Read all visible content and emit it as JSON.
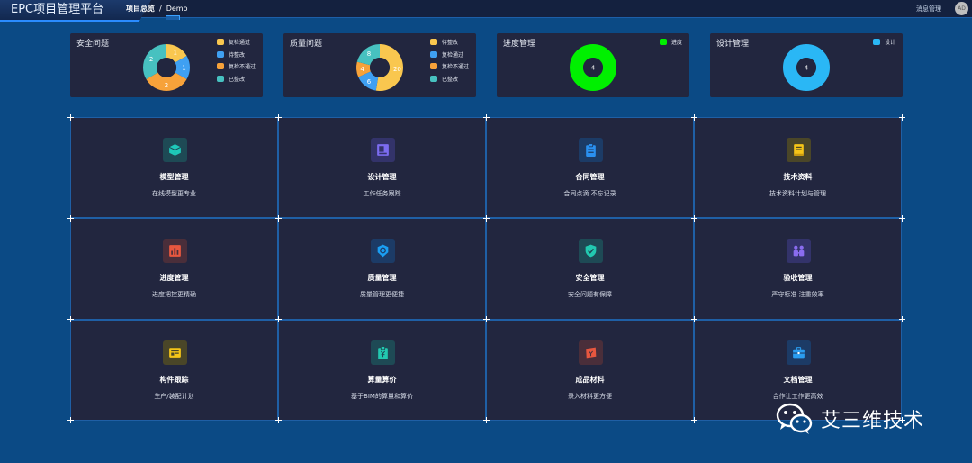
{
  "header": {
    "title": "EPC项目管理平台",
    "breadcrumb": [
      "项目总览",
      "Demo"
    ],
    "breadcrumb_sep": "/",
    "messages": "消息管理",
    "avatar": "AD"
  },
  "stats": [
    {
      "title": "安全问题",
      "legend": [
        {
          "label": "复检通过",
          "color": "#f9c74f"
        },
        {
          "label": "待整改",
          "color": "#3fa0f2"
        },
        {
          "label": "复检不通过",
          "color": "#f7a23a"
        },
        {
          "label": "已整改",
          "color": "#47c1c0"
        }
      ],
      "values": [
        1,
        1,
        2,
        2
      ],
      "value_labels": [
        "1",
        "1",
        "2",
        "2"
      ]
    },
    {
      "title": "质量问题",
      "legend": [
        {
          "label": "待整改",
          "color": "#f9c74f"
        },
        {
          "label": "复检通过",
          "color": "#3fa0f2"
        },
        {
          "label": "复检不通过",
          "color": "#f7a23a"
        },
        {
          "label": "已整改",
          "color": "#47c1c0"
        }
      ],
      "values": [
        20,
        6,
        4,
        8
      ],
      "value_labels": [
        "20",
        "6",
        "4",
        "8"
      ]
    },
    {
      "title": "进度管理",
      "legend": [
        {
          "label": "进度",
          "color": "#00f000"
        }
      ],
      "values": [
        4
      ],
      "value_labels": [
        "4"
      ]
    },
    {
      "title": "设计管理",
      "legend": [
        {
          "label": "设计",
          "color": "#2ab7f5"
        }
      ],
      "values": [
        4
      ],
      "value_labels": [
        "4"
      ]
    }
  ],
  "modules": [
    {
      "title": "模型管理",
      "desc": "在线模型更专业",
      "icon": "cube-icon",
      "color": "#1ec8b8",
      "bg": "#1e4a55"
    },
    {
      "title": "设计管理",
      "desc": "工作任务跟踪",
      "icon": "design-board-icon",
      "color": "#7c6cf0",
      "bg": "#33336a"
    },
    {
      "title": "合同管理",
      "desc": "合同点滴 不忘记录",
      "icon": "clipboard-icon",
      "color": "#2a90f0",
      "bg": "#1c3b66"
    },
    {
      "title": "技术资料",
      "desc": "技术资料计划与管理",
      "icon": "book-icon",
      "color": "#f5c518",
      "bg": "#4a4628"
    },
    {
      "title": "进度管理",
      "desc": "进度把控更精确",
      "icon": "progress-chart-icon",
      "color": "#e8573f",
      "bg": "#4a2e3a"
    },
    {
      "title": "质量管理",
      "desc": "质量管理更便捷",
      "icon": "quality-badge-icon",
      "color": "#1a9ef2",
      "bg": "#1c3b66"
    },
    {
      "title": "安全管理",
      "desc": "安全问题有保障",
      "icon": "shield-check-icon",
      "color": "#22c9b0",
      "bg": "#1e4a55"
    },
    {
      "title": "验收管理",
      "desc": "严守标准 注重效率",
      "icon": "people-icon",
      "color": "#8a6cf0",
      "bg": "#33336a"
    },
    {
      "title": "构件跟踪",
      "desc": "生产/装配计划",
      "icon": "form-card-icon",
      "color": "#f5c518",
      "bg": "#4a4628"
    },
    {
      "title": "算量算价",
      "desc": "基于BIM的算量和算价",
      "icon": "price-tag-icon",
      "color": "#22c9b0",
      "bg": "#1e4a55"
    },
    {
      "title": "成品材料",
      "desc": "录入材料更方便",
      "icon": "material-ticket-icon",
      "color": "#e8573f",
      "bg": "#4a2e3a"
    },
    {
      "title": "文档管理",
      "desc": "合作让工作更高效",
      "icon": "briefcase-icon",
      "color": "#2a9df0",
      "bg": "#1c3b66"
    }
  ],
  "watermark": "艾三维技术"
}
